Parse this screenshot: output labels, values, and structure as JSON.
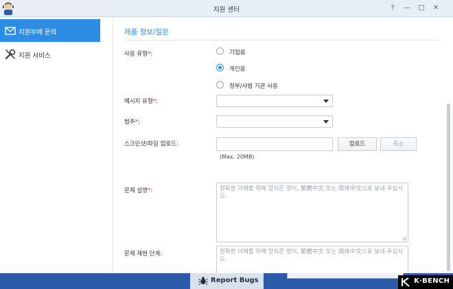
{
  "window": {
    "title": "지원 센터",
    "help_label": "?",
    "minimize_label": "—",
    "maximize_label": "□",
    "close_label": "✕"
  },
  "sidebar": {
    "items": [
      {
        "label": "지원부에 문의",
        "icon": "envelope-icon",
        "active": true
      },
      {
        "label": "지원 서비스",
        "icon": "wrench-icon",
        "active": false
      }
    ]
  },
  "form": {
    "section_title": "제품 정보/질문",
    "usage_type": {
      "label": "사용 유형",
      "required_mark": "*",
      "colon": ":",
      "options": [
        "기업용",
        "개인용",
        "정부/사법 기관 사용"
      ],
      "selected": "개인용"
    },
    "message_type": {
      "label": "메시지 유형",
      "required_mark": "*",
      "colon": ":",
      "value": ""
    },
    "category": {
      "label": "범주",
      "required_mark": "*",
      "colon": ":",
      "value": ""
    },
    "upload": {
      "label": "스크린샷/파일 업로드:",
      "value": "",
      "upload_button": "업로드",
      "cancel_button": "취소",
      "hint": "(Max. 20MB)"
    },
    "problem_description": {
      "label": "문제 설명",
      "required_mark": "*",
      "colon": ":",
      "placeholder": "정확한 이해를 위해 양식은 영어, 繁體中文 또는 简体中文으로 보내 주십시오."
    },
    "reproduce_steps": {
      "label": "문제 재현 단계:",
      "placeholder": "정확한 이해를 위해 양식은 영어, 繁體中文 또는 简体中文으로 보내 주십시오."
    }
  },
  "taskbar": {
    "active_app": "Report Bugs",
    "active_icon": "bug-icon"
  },
  "watermark": {
    "brand": "K·BENCH"
  },
  "colors": {
    "accent": "#2d8ce3",
    "taskbar": "#2b5aa8",
    "required": "#ee3333"
  }
}
